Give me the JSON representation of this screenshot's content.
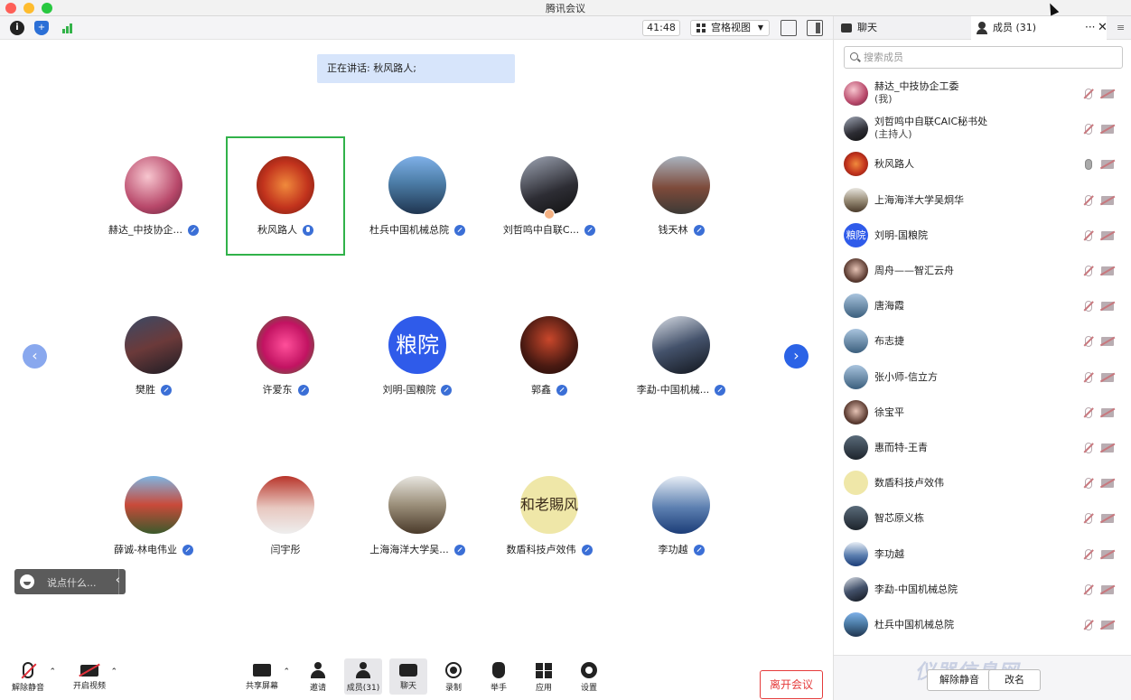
{
  "window": {
    "title": "腾讯会议"
  },
  "topbar": {
    "timer": "41:48",
    "view_mode": "宫格视图"
  },
  "speaking_banner": "正在讲话: 秋风路人;",
  "grid": [
    {
      "name": "赫达_中技协企...",
      "avatar": "a1",
      "mic": "muted"
    },
    {
      "name": "秋风路人",
      "avatar": "a2",
      "mic": "on",
      "active": true
    },
    {
      "name": "杜兵中国机械总院",
      "avatar": "a3",
      "mic": "muted"
    },
    {
      "name": "刘哲鸣中自联C...",
      "avatar": "a4",
      "mic": "muted",
      "host": true
    },
    {
      "name": "钱天林",
      "avatar": "a5",
      "mic": "muted"
    },
    {
      "name": "樊胜",
      "avatar": "a6",
      "mic": "muted"
    },
    {
      "name": "许爱东",
      "avatar": "a7",
      "mic": "muted"
    },
    {
      "name": "刘明-国粮院",
      "avatar": "txt",
      "avatar_text": "粮院",
      "mic": "muted"
    },
    {
      "name": "郭鑫",
      "avatar": "a9",
      "mic": "muted"
    },
    {
      "name": "李勐-中国机械...",
      "avatar": "a10",
      "mic": "muted"
    },
    {
      "name": "薛诚-林电伟业",
      "avatar": "a11",
      "mic": "muted"
    },
    {
      "name": "闫宇彤",
      "avatar": "a12",
      "mic": "none"
    },
    {
      "name": "上海海洋大学吴...",
      "avatar": "a13",
      "mic": "muted"
    },
    {
      "name": "数盾科技卢效伟",
      "avatar": "a14",
      "avatar_text": "和老賜风",
      "mic": "muted"
    },
    {
      "name": "李功越",
      "avatar": "a15",
      "mic": "muted"
    }
  ],
  "chat_input": {
    "placeholder": "说点什么..."
  },
  "toolbar": {
    "unmute": "解除静音",
    "start_video": "开启视频",
    "share_screen": "共享屏幕",
    "invite": "邀请",
    "members": "成员(31)",
    "chat": "聊天",
    "record": "录制",
    "raise_hand": "举手",
    "apps": "应用",
    "settings": "设置",
    "leave": "离开会议"
  },
  "panel": {
    "tab_chat": "聊天",
    "tab_members": "成员 (31)",
    "search_placeholder": "搜索成员",
    "members": [
      {
        "name": "赫达_中技协企工委",
        "sub": "(我)",
        "av": "a1",
        "mic": "muted"
      },
      {
        "name": "刘哲鸣中自联CAIC秘书处",
        "sub": "(主持人)",
        "av": "a4",
        "mic": "muted"
      },
      {
        "name": "秋风路人",
        "av": "a2",
        "mic": "live"
      },
      {
        "name": "上海海洋大学吴炯华",
        "av": "a13",
        "mic": "muted"
      },
      {
        "name": "刘明-国粮院",
        "av": "txt",
        "av_text": "粮院",
        "mic": "muted"
      },
      {
        "name": "周舟——智汇云舟",
        "av": "face",
        "mic": "muted"
      },
      {
        "name": "唐海霞",
        "av": "sea",
        "mic": "muted"
      },
      {
        "name": "布志捷",
        "av": "sea",
        "mic": "muted"
      },
      {
        "name": "张小师-信立方",
        "av": "sea",
        "mic": "muted"
      },
      {
        "name": "徐宝平",
        "av": "face",
        "mic": "muted"
      },
      {
        "name": "惠而特-王青",
        "av": "dark",
        "mic": "muted"
      },
      {
        "name": "数盾科技卢效伟",
        "av": "a14",
        "mic": "muted"
      },
      {
        "name": "智芯原义栋",
        "av": "dark",
        "mic": "muted"
      },
      {
        "name": "李功越",
        "av": "a15",
        "mic": "muted"
      },
      {
        "name": "李勐-中国机械总院",
        "av": "a10",
        "mic": "muted"
      },
      {
        "name": "杜兵中国机械总院",
        "av": "a3",
        "mic": "muted"
      }
    ],
    "mute_all": "解除静音",
    "rename": "改名",
    "watermark": "仪器信息网"
  }
}
